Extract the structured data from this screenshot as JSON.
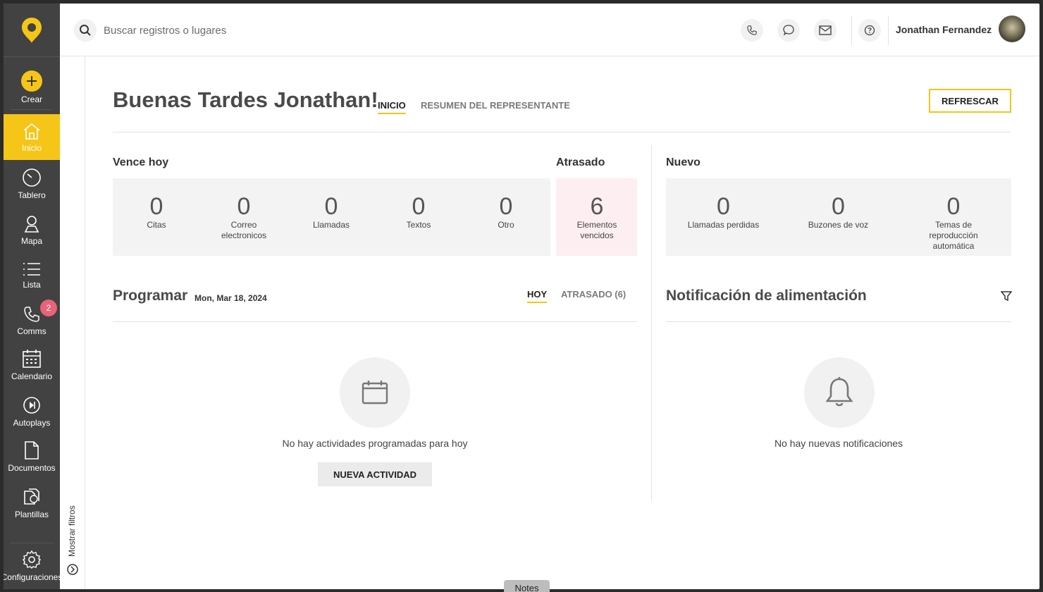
{
  "sidebar": {
    "items": [
      {
        "label": "Crear",
        "icon": "plus-circle-icon"
      },
      {
        "label": "Inicio",
        "icon": "home-icon"
      },
      {
        "label": "Tablero",
        "icon": "dashboard-gauge-icon"
      },
      {
        "label": "Mapa",
        "icon": "map-person-icon"
      },
      {
        "label": "Lista",
        "icon": "list-icon"
      },
      {
        "label": "Comms",
        "icon": "phone-icon"
      },
      {
        "label": "Calendario",
        "icon": "calendar-icon"
      },
      {
        "label": "Autoplays",
        "icon": "autoplay-icon"
      },
      {
        "label": "Documentos",
        "icon": "document-icon"
      },
      {
        "label": "Plantillas",
        "icon": "templates-icon"
      },
      {
        "label": "Configuraciones",
        "icon": "gear-icon"
      }
    ],
    "comms_badge": "2"
  },
  "filters": {
    "label": "Mostrar filtros"
  },
  "header": {
    "search_placeholder": "Buscar registros o lugares",
    "user_name": "Jonathan Fernandez"
  },
  "main": {
    "greeting": "Buenas Tardes Jonathan!",
    "tabs": [
      "INICIO",
      "RESUMEN DEL REPRESENTANTE"
    ],
    "refresh_label": "REFRESCAR",
    "due_today": {
      "title": "Vence hoy",
      "stats": [
        {
          "value": "0",
          "label": "Citas"
        },
        {
          "value": "0",
          "label": "Correo electronicos"
        },
        {
          "value": "0",
          "label": "Llamadas"
        },
        {
          "value": "0",
          "label": "Textos"
        },
        {
          "value": "0",
          "label": "Otro"
        }
      ]
    },
    "overdue": {
      "title": "Atrasado",
      "value": "6",
      "label": "Elementos vencidos"
    },
    "new": {
      "title": "Nuevo",
      "stats": [
        {
          "value": "0",
          "label": "Llamadas perdidas"
        },
        {
          "value": "0",
          "label": "Buzones de voz"
        },
        {
          "value": "0",
          "label": "Temas de reproducción automática"
        }
      ]
    },
    "schedule": {
      "title": "Programar",
      "date": "Mon, Mar 18, 2024",
      "tabs": [
        "HOY",
        "ATRASADO (6)"
      ],
      "empty_text": "No hay actividades programadas para hoy",
      "button": "NUEVA ACTIVIDAD"
    },
    "feed": {
      "title": "Notificación de alimentación",
      "empty_text": "No hay nuevas notificaciones"
    }
  },
  "notes_tab": "Notes",
  "colors": {
    "accent": "#f5c518",
    "sidebar": "#424242",
    "badge": "#e8637a",
    "overdue_bg": "#fdeff1"
  }
}
